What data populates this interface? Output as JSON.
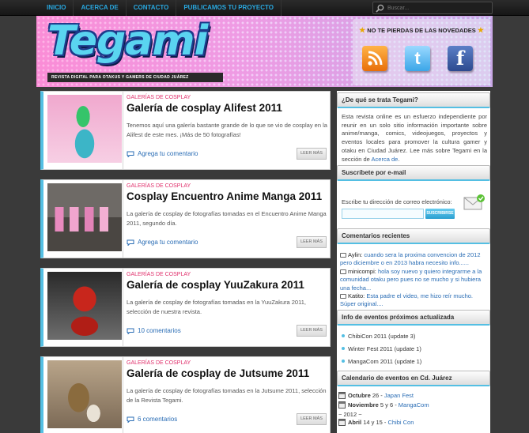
{
  "nav": {
    "items": [
      "INICIO",
      "ACERCA DE",
      "CONTACTO",
      "PUBLICAMOS TU PROYECTO"
    ],
    "search_placeholder": "Buscar..."
  },
  "header": {
    "logo": "Tegami",
    "tagline": "REVISTA DIGITAL PARA OTAKUS Y GAMERS DE CIUDAD JUÁREZ",
    "social_title": "NO TE PIERDAS DE LAS NOVEDADES",
    "social_icons": [
      "rss-icon",
      "twitter-icon",
      "facebook-icon"
    ]
  },
  "colors": {
    "accent": "#54bfe3",
    "category": "#e0306c",
    "link": "#2a6db5",
    "nav_text": "#29a8e0"
  },
  "posts": [
    {
      "category": "GALERÍAS DE COSPLAY",
      "title": "Galería de cosplay Alifest 2011",
      "excerpt": "Tenemos aquí una galería bastante grande de lo que se vio de cosplay en la Alifest de este mes. ¡Más de 50 fotografías!",
      "comments": "Agrega tu comentario",
      "more": "LEER MÁS"
    },
    {
      "category": "GALERÍAS DE COSPLAY",
      "title": "Cosplay Encuentro Anime Manga 2011",
      "excerpt": "La galería de cosplay de fotografías tomadas en el Encuentro Anime Manga 2011, segundo día.",
      "comments": "Agrega tu comentario",
      "more": "LEER MÁS"
    },
    {
      "category": "GALERÍAS DE COSPLAY",
      "title": "Galería de cosplay YuuZakura 2011",
      "excerpt": "La galería de cosplay de fotografías tomadas en la YuuZakura 2011, selección de nuestra revista.",
      "comments": "10 comentarios",
      "more": "LEER MÁS"
    },
    {
      "category": "GALERÍAS DE COSPLAY",
      "title": "Galería de cosplay de Jutsume 2011",
      "excerpt": "La galería de cosplay de fotografías tomadas en la Jutsume 2011, selección de la Revista Tegami.",
      "comments": "6 comentarios",
      "more": "LEER MÁS"
    }
  ],
  "sidebar": {
    "about": {
      "title": "¿De qué se trata Tegami?",
      "text": "Esta revista online es un esfuerzo independiente por reunir en un solo sitio información importante sobre anime/manga, comics, videojuegos, proyectos y eventos locales para promover la cultura gamer y otaku en Ciudad Juárez. Lee más sobre Tegami en la sección de ",
      "link": "Acerca de",
      "end": "."
    },
    "email": {
      "title": "Suscríbete por e-mail",
      "label": "Escribe tu dirección de correo electrónico:",
      "button": "SUSCRIBIRSE"
    },
    "recent_comments": {
      "title": "Comentarios recientes",
      "items": [
        {
          "author": "Aylin:",
          "text": "cuando sera la proxima convencion de 2012 pero diciembre o en 2013 habra necesito info......"
        },
        {
          "author": "minicompi:",
          "text": "hola soy nuevo y quiero integrarme a la comunidad otaku pero pues no se mucho y si hubiera una fecha..."
        },
        {
          "author": "Katito:",
          "text": "Esta padre el video, me hizo reír mucho. Súper original...."
        }
      ]
    },
    "events": {
      "title": "Info de eventos próximos actualizada",
      "items": [
        "ChibiCon 2011 (update 3)",
        "Winter Fest 2011 (update 1)",
        "MangaCom 2011 (update 1)"
      ]
    },
    "calendar": {
      "title": "Calendario de eventos en Cd. Juárez",
      "rows": [
        {
          "month": "Octubre",
          "days": "26 - ",
          "event": "Japan Fest"
        },
        {
          "month": "Noviembre",
          "days": "5 y 6 - ",
          "event": "MangaCom"
        },
        {
          "year": "~ 2012 ~"
        },
        {
          "month": "Abril",
          "days": "14 y 15 - ",
          "event": "Chibi Con"
        }
      ]
    }
  }
}
